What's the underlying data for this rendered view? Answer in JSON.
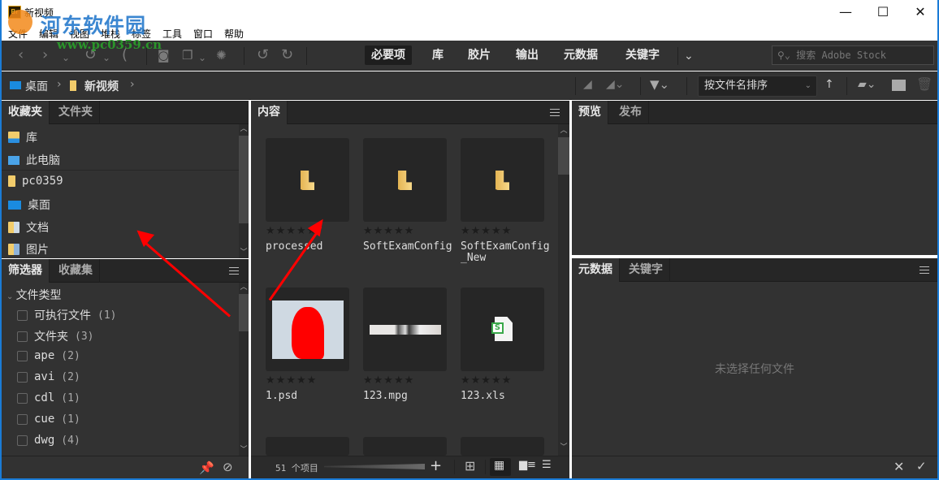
{
  "window": {
    "title": "新视频",
    "app_icon": "Br",
    "minimize": "—",
    "maximize": "☐",
    "close": "✕"
  },
  "watermark": {
    "text": "河东软件园",
    "url": "www.pc0359.cn"
  },
  "menu": [
    "文件",
    "编辑",
    "视图",
    "堆栈",
    "标签",
    "工具",
    "窗口",
    "帮助"
  ],
  "toolbar": {
    "workspaces": [
      {
        "label": "必要项",
        "active": true
      },
      {
        "label": "库"
      },
      {
        "label": "胶片"
      },
      {
        "label": "输出"
      },
      {
        "label": "元数据"
      },
      {
        "label": "关键字"
      }
    ],
    "more": "⌄",
    "search_placeholder": "搜索 Adobe Stock"
  },
  "pathbar": {
    "breadcrumbs": [
      {
        "label": "桌面",
        "icon": "desktop-icon"
      },
      {
        "label": "新视频",
        "icon": "folder-icon"
      }
    ],
    "sort_label": "按文件名排序",
    "sort_direction": "↑"
  },
  "left_top": {
    "tabs": [
      {
        "label": "收藏夹",
        "active": true
      },
      {
        "label": "文件夹"
      }
    ],
    "items": [
      {
        "label": "库",
        "icon": "library-icon"
      },
      {
        "label": "此电脑",
        "icon": "computer-icon"
      },
      {
        "label": "pc0359",
        "icon": "folder-icon"
      },
      {
        "label": "桌面",
        "icon": "desktop-icon"
      },
      {
        "label": "文档",
        "icon": "documents-icon"
      },
      {
        "label": "图片",
        "icon": "pictures-icon"
      }
    ]
  },
  "filter": {
    "tabs": [
      {
        "label": "筛选器",
        "active": true
      },
      {
        "label": "收藏集"
      }
    ],
    "group": "文件类型",
    "rows": [
      {
        "label": "可执行文件",
        "count": "(1)"
      },
      {
        "label": "文件夹",
        "count": "(3)"
      },
      {
        "label": "ape",
        "count": "(2)"
      },
      {
        "label": "avi",
        "count": "(2)"
      },
      {
        "label": "cdl",
        "count": "(1)"
      },
      {
        "label": "cue",
        "count": "(1)"
      },
      {
        "label": "dwg",
        "count": "(4)"
      }
    ]
  },
  "content": {
    "tab": "内容",
    "items": [
      {
        "name": "processed",
        "type": "folder",
        "rating": 0
      },
      {
        "name": "SoftExamConfig",
        "type": "folder",
        "rating": 0
      },
      {
        "name": "SoftExamConfig_New",
        "type": "folder",
        "rating": 0
      },
      {
        "name": "1.psd",
        "type": "image",
        "rating": 0
      },
      {
        "name": "123.mpg",
        "type": "video",
        "rating": 0
      },
      {
        "name": "123.xls",
        "type": "spreadsheet",
        "rating": 0
      }
    ],
    "stars": "★★★★★",
    "item_count": "51 个项目"
  },
  "preview": {
    "tabs": [
      {
        "label": "预览",
        "active": true
      },
      {
        "label": "发布"
      }
    ]
  },
  "metadata": {
    "tabs": [
      {
        "label": "元数据",
        "active": true
      },
      {
        "label": "关键字"
      }
    ],
    "empty_text": "未选择任何文件"
  }
}
